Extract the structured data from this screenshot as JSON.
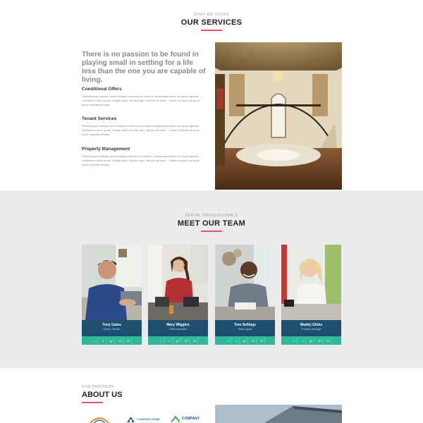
{
  "services": {
    "eyebrow": "WHAT WE OFFER",
    "title": "OUR SERVICES",
    "lead": "There is no passion to be found in playing small in settling for a life less than the one you are capable of living.",
    "items": [
      {
        "heading": "Conditional Offers",
        "body": "Pellentesque habitant morbi tristique senectus et netus et malesuada fames ac turpis egestas. Vestibulum tortor quam, feugiat vitae, ultricies eget, tempor sit amet, . Donec eu libero sit amet quam egestas semper."
      },
      {
        "heading": "Tenant Services",
        "body": "Pellentesque habitant morbi tristique senectus et netus et malesuada fames ac turpis egestas. Vestibulum tortor quam, feugiat vitae, ultricies eget, tempor sit amet, . Donec eu libero sit amet quam egestas semper."
      },
      {
        "heading": "Property Management",
        "body": "Pellentesque habitant morbi tristique senectus et netus et malesuada fames ac turpis egestas. Vestibulum tortor quam, feugiat vitae, ultricies eget, tempor sit amet, . Donec eu libero sit amet quam egestas semper."
      }
    ]
  },
  "team": {
    "eyebrow": "RENTAL PROFESSIONALS",
    "title": "MEET OUR TEAM",
    "members": [
      {
        "name": "Tony Gates",
        "role": "Owner / Broker"
      },
      {
        "name": "Mary Wiggins",
        "role": "Office Assistant"
      },
      {
        "name": "Tom Sellings",
        "role": "Sales Agent"
      },
      {
        "name": "Maddy Gibbs",
        "role": "Property Manager"
      }
    ],
    "social_icons": [
      "f",
      "t",
      "g+",
      "✉",
      "✆"
    ]
  },
  "about": {
    "eyebrow": "OUR PARTNERS",
    "title": "ABOUT US",
    "logos": [
      {
        "text": ""
      },
      {
        "text": "COMPANY NAME"
      },
      {
        "text": "COMPANY"
      }
    ]
  },
  "colors": {
    "accent": "#e3546b",
    "info_bar": "#1f4f6e",
    "social_bar": "#2fb89a",
    "team_bg": "#ebebeb"
  }
}
